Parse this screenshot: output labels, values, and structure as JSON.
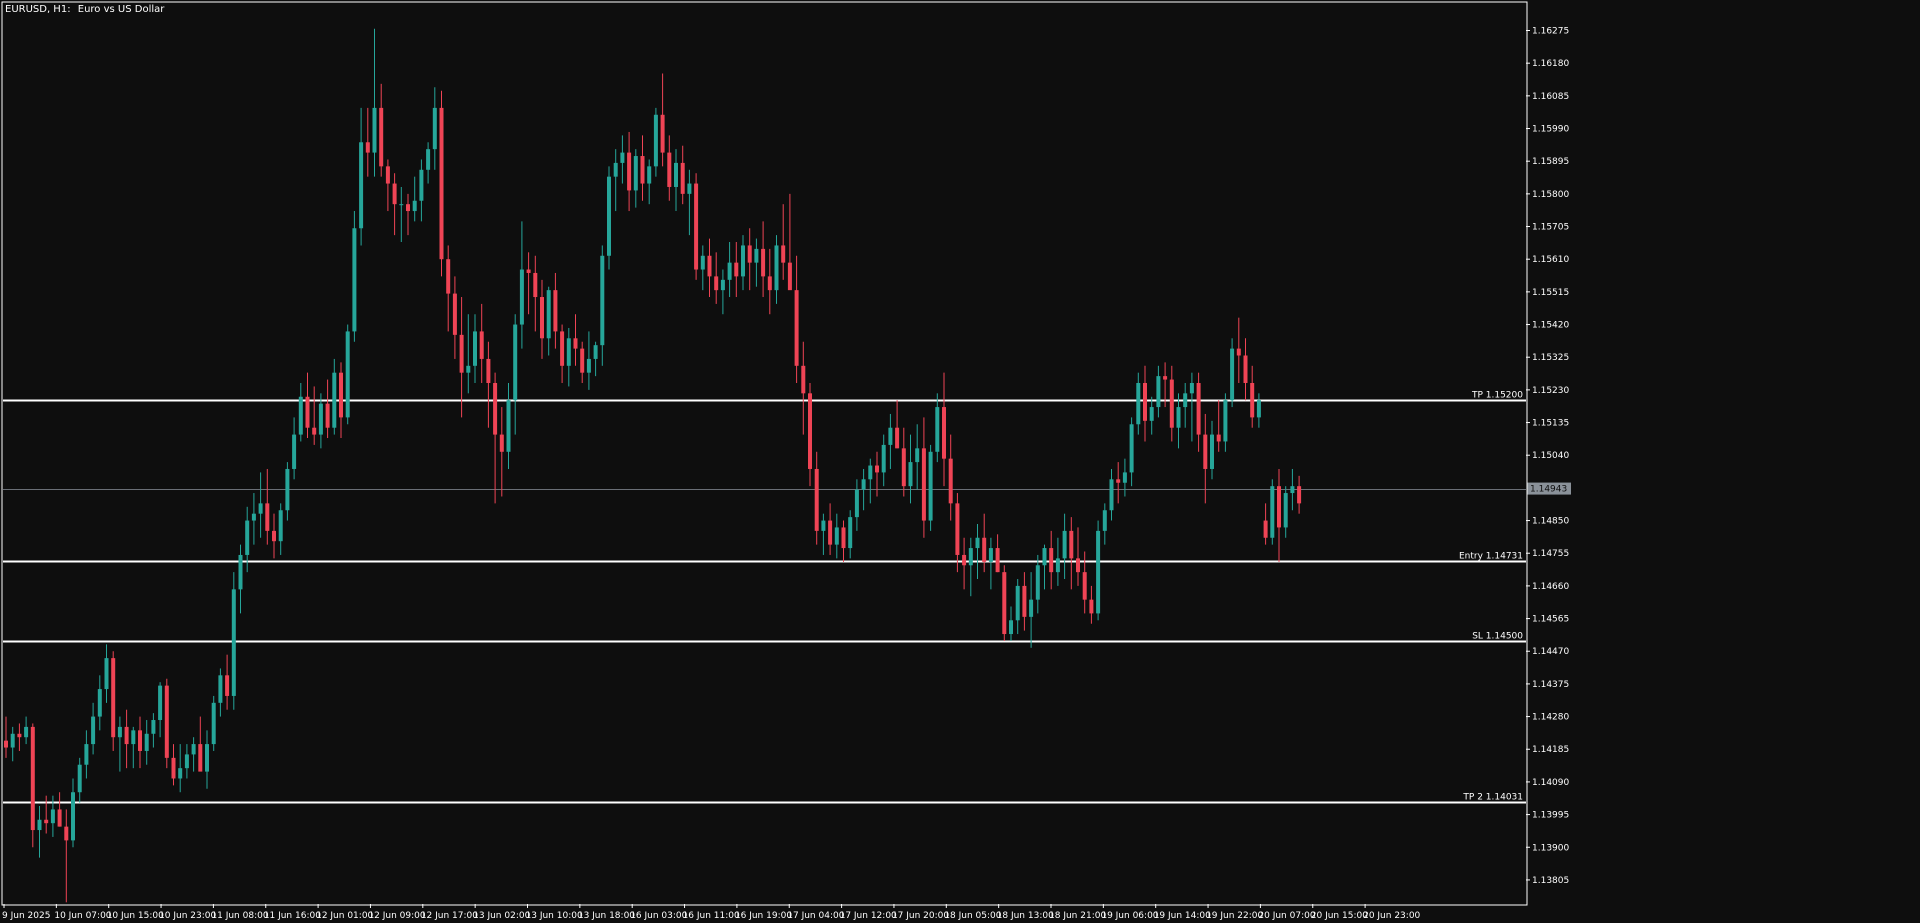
{
  "chart": {
    "symbol": "EURUSD, H1:",
    "description": "Euro vs US Dollar",
    "current_price": "1.14943"
  },
  "colors": {
    "background": "#0e0e0e",
    "bull": "#26a69a",
    "bear": "#ef4455",
    "axis": "#ffffff",
    "level_line": "#ffffff",
    "current_line": "#6a6f76",
    "price_tag": "#8a9199"
  },
  "levels": [
    {
      "label": "TP 1.15200",
      "price": 1.152
    },
    {
      "label": "Entry 1.14731",
      "price": 1.14731
    },
    {
      "label": "SL 1.14500",
      "price": 1.145
    },
    {
      "label": "TP 2 1.14031",
      "price": 1.14031
    }
  ],
  "chart_data": {
    "type": "candlestick",
    "ylim": [
      1.13735,
      1.16355
    ],
    "y_ticks": [
      "1.16275",
      "1.16180",
      "1.16085",
      "1.15990",
      "1.15895",
      "1.15800",
      "1.15705",
      "1.15610",
      "1.15515",
      "1.15420",
      "1.15325",
      "1.15230",
      "1.15135",
      "1.15040",
      "1.14943",
      "1.14850",
      "1.14755",
      "1.14660",
      "1.14565",
      "1.14470",
      "1.14375",
      "1.14280",
      "1.14185",
      "1.14090",
      "1.13995",
      "1.13900",
      "1.13805"
    ],
    "x_ticks": [
      "9 Jun 2025",
      "10 Jun 07:00",
      "10 Jun 15:00",
      "10 Jun 23:00",
      "11 Jun 08:00",
      "11 Jun 16:00",
      "12 Jun 01:00",
      "12 Jun 09:00",
      "12 Jun 17:00",
      "13 Jun 02:00",
      "13 Jun 10:00",
      "13 Jun 18:00",
      "16 Jun 03:00",
      "16 Jun 11:00",
      "16 Jun 19:00",
      "17 Jun 04:00",
      "17 Jun 12:00",
      "17 Jun 20:00",
      "18 Jun 05:00",
      "18 Jun 13:00",
      "18 Jun 21:00",
      "19 Jun 06:00",
      "19 Jun 14:00",
      "19 Jun 22:00",
      "20 Jun 07:00",
      "20 Jun 15:00",
      "20 Jun 23:00"
    ],
    "candles_ohlc": [
      [
        1.1421,
        1.1428,
        1.1416,
        1.1419
      ],
      [
        1.1419,
        1.1425,
        1.1415,
        1.1423
      ],
      [
        1.1423,
        1.1426,
        1.1418,
        1.1422
      ],
      [
        1.1422,
        1.1428,
        1.142,
        1.1425
      ],
      [
        1.1425,
        1.1426,
        1.139,
        1.1395
      ],
      [
        1.1395,
        1.1402,
        1.1387,
        1.1398
      ],
      [
        1.1398,
        1.1405,
        1.1394,
        1.1397
      ],
      [
        1.1397,
        1.1405,
        1.1393,
        1.1401
      ],
      [
        1.1401,
        1.1406,
        1.1396,
        1.1396
      ],
      [
        1.1396,
        1.1401,
        1.1374,
        1.1392
      ],
      [
        1.1392,
        1.141,
        1.139,
        1.1406
      ],
      [
        1.1406,
        1.1416,
        1.1403,
        1.1414
      ],
      [
        1.1414,
        1.1424,
        1.141,
        1.142
      ],
      [
        1.142,
        1.1432,
        1.1417,
        1.1428
      ],
      [
        1.1428,
        1.144,
        1.1424,
        1.1436
      ],
      [
        1.1436,
        1.1449,
        1.1432,
        1.1445
      ],
      [
        1.1445,
        1.1447,
        1.1418,
        1.1422
      ],
      [
        1.1422,
        1.1428,
        1.1412,
        1.1425
      ],
      [
        1.1425,
        1.143,
        1.1413,
        1.142
      ],
      [
        1.142,
        1.1425,
        1.1413,
        1.1424
      ],
      [
        1.1424,
        1.1428,
        1.1413,
        1.1418
      ],
      [
        1.1418,
        1.1427,
        1.1414,
        1.1423
      ],
      [
        1.1423,
        1.1429,
        1.1419,
        1.1427
      ],
      [
        1.1427,
        1.1438,
        1.1422,
        1.1437
      ],
      [
        1.1437,
        1.1439,
        1.1413,
        1.1416
      ],
      [
        1.1416,
        1.142,
        1.1408,
        1.141
      ],
      [
        1.141,
        1.142,
        1.1406,
        1.1413
      ],
      [
        1.1413,
        1.142,
        1.141,
        1.1417
      ],
      [
        1.1417,
        1.1422,
        1.1412,
        1.142
      ],
      [
        1.142,
        1.1428,
        1.1414,
        1.1412
      ],
      [
        1.1412,
        1.1424,
        1.1407,
        1.142
      ],
      [
        1.142,
        1.1434,
        1.1418,
        1.1432
      ],
      [
        1.1432,
        1.1442,
        1.1428,
        1.144
      ],
      [
        1.144,
        1.1446,
        1.143,
        1.1434
      ],
      [
        1.1434,
        1.147,
        1.143,
        1.1465
      ],
      [
        1.1465,
        1.1478,
        1.1458,
        1.1475
      ],
      [
        1.1475,
        1.1489,
        1.147,
        1.1485
      ],
      [
        1.1485,
        1.1493,
        1.1478,
        1.1487
      ],
      [
        1.1487,
        1.1499,
        1.148,
        1.149
      ],
      [
        1.149,
        1.15,
        1.1478,
        1.1482
      ],
      [
        1.1482,
        1.1487,
        1.1474,
        1.1479
      ],
      [
        1.1479,
        1.149,
        1.1475,
        1.1488
      ],
      [
        1.1488,
        1.1502,
        1.1485,
        1.15
      ],
      [
        1.15,
        1.1515,
        1.1497,
        1.151
      ],
      [
        1.151,
        1.1525,
        1.1508,
        1.1521
      ],
      [
        1.1521,
        1.1528,
        1.1509,
        1.1512
      ],
      [
        1.1512,
        1.1524,
        1.1507,
        1.151
      ],
      [
        1.151,
        1.1522,
        1.1506,
        1.1519
      ],
      [
        1.1519,
        1.1526,
        1.1509,
        1.1512
      ],
      [
        1.1512,
        1.1532,
        1.151,
        1.1528
      ],
      [
        1.1528,
        1.1531,
        1.1509,
        1.1515
      ],
      [
        1.1515,
        1.1542,
        1.1513,
        1.154
      ],
      [
        1.154,
        1.1575,
        1.1537,
        1.157
      ],
      [
        1.157,
        1.1605,
        1.1565,
        1.1595
      ],
      [
        1.1595,
        1.1605,
        1.1585,
        1.1592
      ],
      [
        1.1592,
        1.1628,
        1.1585,
        1.1605
      ],
      [
        1.1605,
        1.1612,
        1.1585,
        1.1588
      ],
      [
        1.1588,
        1.159,
        1.1575,
        1.1583
      ],
      [
        1.1583,
        1.1586,
        1.1568,
        1.1577
      ],
      [
        1.1577,
        1.1582,
        1.1566,
        1.1577
      ],
      [
        1.1577,
        1.158,
        1.1568,
        1.1575
      ],
      [
        1.1575,
        1.1585,
        1.1572,
        1.1578
      ],
      [
        1.1578,
        1.159,
        1.1572,
        1.1587
      ],
      [
        1.1587,
        1.1595,
        1.1583,
        1.1593
      ],
      [
        1.1593,
        1.1611,
        1.1587,
        1.1605
      ],
      [
        1.1605,
        1.161,
        1.1556,
        1.1561
      ],
      [
        1.1561,
        1.1565,
        1.154,
        1.1551
      ],
      [
        1.1551,
        1.1556,
        1.1532,
        1.1539
      ],
      [
        1.1539,
        1.155,
        1.1515,
        1.1528
      ],
      [
        1.1528,
        1.1545,
        1.1522,
        1.153
      ],
      [
        1.153,
        1.1545,
        1.1525,
        1.154
      ],
      [
        1.154,
        1.1548,
        1.1525,
        1.1532
      ],
      [
        1.1532,
        1.1537,
        1.1512,
        1.1525
      ],
      [
        1.1525,
        1.1528,
        1.149,
        1.151
      ],
      [
        1.151,
        1.1518,
        1.1492,
        1.1505
      ],
      [
        1.1505,
        1.1525,
        1.15,
        1.152
      ],
      [
        1.152,
        1.1545,
        1.151,
        1.1542
      ],
      [
        1.1542,
        1.1572,
        1.1535,
        1.1558
      ],
      [
        1.1558,
        1.1563,
        1.1545,
        1.1557
      ],
      [
        1.1557,
        1.1562,
        1.154,
        1.155
      ],
      [
        1.155,
        1.1555,
        1.1532,
        1.1538
      ],
      [
        1.1538,
        1.1553,
        1.1533,
        1.1552
      ],
      [
        1.1552,
        1.1557,
        1.1535,
        1.154
      ],
      [
        1.154,
        1.1542,
        1.1525,
        1.153
      ],
      [
        1.153,
        1.1541,
        1.1524,
        1.1538
      ],
      [
        1.1538,
        1.1545,
        1.153,
        1.1535
      ],
      [
        1.1535,
        1.1537,
        1.1525,
        1.1528
      ],
      [
        1.1528,
        1.154,
        1.1523,
        1.1532
      ],
      [
        1.1532,
        1.1537,
        1.1527,
        1.1536
      ],
      [
        1.1536,
        1.1565,
        1.153,
        1.1562
      ],
      [
        1.1562,
        1.1588,
        1.1558,
        1.1585
      ],
      [
        1.1585,
        1.1593,
        1.1575,
        1.1589
      ],
      [
        1.1589,
        1.1597,
        1.1583,
        1.1592
      ],
      [
        1.1592,
        1.1598,
        1.1575,
        1.1581
      ],
      [
        1.1581,
        1.1593,
        1.1576,
        1.1591
      ],
      [
        1.1591,
        1.1597,
        1.1578,
        1.1583
      ],
      [
        1.1583,
        1.159,
        1.1577,
        1.1588
      ],
      [
        1.1588,
        1.1605,
        1.1585,
        1.1603
      ],
      [
        1.1603,
        1.1615,
        1.1588,
        1.1592
      ],
      [
        1.1592,
        1.1597,
        1.1578,
        1.1582
      ],
      [
        1.1582,
        1.1593,
        1.1575,
        1.1589
      ],
      [
        1.1589,
        1.1594,
        1.1577,
        1.158
      ],
      [
        1.158,
        1.1587,
        1.1568,
        1.1583
      ],
      [
        1.1583,
        1.1586,
        1.1555,
        1.1558
      ],
      [
        1.1558,
        1.1565,
        1.1552,
        1.1562
      ],
      [
        1.1562,
        1.1567,
        1.155,
        1.1556
      ],
      [
        1.1556,
        1.1563,
        1.1548,
        1.1552
      ],
      [
        1.1552,
        1.1558,
        1.1545,
        1.1555
      ],
      [
        1.1555,
        1.1566,
        1.155,
        1.156
      ],
      [
        1.156,
        1.1566,
        1.155,
        1.1556
      ],
      [
        1.1556,
        1.1568,
        1.1552,
        1.1565
      ],
      [
        1.1565,
        1.157,
        1.1552,
        1.156
      ],
      [
        1.156,
        1.1567,
        1.1553,
        1.1564
      ],
      [
        1.1564,
        1.1572,
        1.155,
        1.1556
      ],
      [
        1.1556,
        1.1564,
        1.1545,
        1.1552
      ],
      [
        1.1552,
        1.1568,
        1.1548,
        1.1565
      ],
      [
        1.1565,
        1.1577,
        1.1555,
        1.156
      ],
      [
        1.156,
        1.158,
        1.1555,
        1.1552
      ],
      [
        1.1552,
        1.1562,
        1.1525,
        1.153
      ],
      [
        1.153,
        1.1537,
        1.151,
        1.1522
      ],
      [
        1.1522,
        1.1525,
        1.1495,
        1.15
      ],
      [
        1.15,
        1.1505,
        1.1478,
        1.1482
      ],
      [
        1.1482,
        1.1487,
        1.1475,
        1.1485
      ],
      [
        1.1485,
        1.149,
        1.1475,
        1.1478
      ],
      [
        1.1478,
        1.1487,
        1.1474,
        1.1483
      ],
      [
        1.1483,
        1.1485,
        1.1473,
        1.1477
      ],
      [
        1.1477,
        1.1488,
        1.1474,
        1.1486
      ],
      [
        1.1486,
        1.1497,
        1.1482,
        1.1494
      ],
      [
        1.1494,
        1.15,
        1.1488,
        1.1497
      ],
      [
        1.1497,
        1.1503,
        1.149,
        1.1501
      ],
      [
        1.1501,
        1.1505,
        1.1492,
        1.1499
      ],
      [
        1.1499,
        1.151,
        1.1495,
        1.1507
      ],
      [
        1.1507,
        1.1516,
        1.15,
        1.1512
      ],
      [
        1.1512,
        1.152,
        1.1506,
        1.1506
      ],
      [
        1.1506,
        1.1512,
        1.1492,
        1.1495
      ],
      [
        1.1495,
        1.151,
        1.149,
        1.1502
      ],
      [
        1.1502,
        1.1513,
        1.1494,
        1.1506
      ],
      [
        1.1506,
        1.1515,
        1.148,
        1.1485
      ],
      [
        1.1485,
        1.1507,
        1.1482,
        1.1505
      ],
      [
        1.1505,
        1.1522,
        1.1502,
        1.1518
      ],
      [
        1.1518,
        1.1528,
        1.1495,
        1.1503
      ],
      [
        1.1503,
        1.151,
        1.1485,
        1.149
      ],
      [
        1.149,
        1.1493,
        1.147,
        1.1475
      ],
      [
        1.1475,
        1.148,
        1.1465,
        1.1472
      ],
      [
        1.1472,
        1.148,
        1.1463,
        1.1477
      ],
      [
        1.1477,
        1.1484,
        1.1468,
        1.148
      ],
      [
        1.148,
        1.1487,
        1.147,
        1.1473
      ],
      [
        1.1473,
        1.148,
        1.1465,
        1.1477
      ],
      [
        1.1477,
        1.1481,
        1.147,
        1.147
      ],
      [
        1.147,
        1.1472,
        1.145,
        1.1452
      ],
      [
        1.1452,
        1.146,
        1.145,
        1.1456
      ],
      [
        1.1456,
        1.1468,
        1.1452,
        1.1466
      ],
      [
        1.1466,
        1.147,
        1.1453,
        1.1457
      ],
      [
        1.1457,
        1.147,
        1.1448,
        1.1462
      ],
      [
        1.1462,
        1.1475,
        1.1458,
        1.1472
      ],
      [
        1.1472,
        1.1478,
        1.1465,
        1.1477
      ],
      [
        1.1477,
        1.1482,
        1.1465,
        1.147
      ],
      [
        1.147,
        1.148,
        1.1466,
        1.1474
      ],
      [
        1.1474,
        1.1487,
        1.1468,
        1.1482
      ],
      [
        1.1482,
        1.1486,
        1.1465,
        1.1474
      ],
      [
        1.1474,
        1.1483,
        1.1466,
        1.147
      ],
      [
        1.147,
        1.1476,
        1.1458,
        1.1462
      ],
      [
        1.1462,
        1.1466,
        1.1455,
        1.1458
      ],
      [
        1.1458,
        1.1485,
        1.1456,
        1.1482
      ],
      [
        1.1482,
        1.149,
        1.1478,
        1.1488
      ],
      [
        1.1488,
        1.15,
        1.1485,
        1.1497
      ],
      [
        1.1497,
        1.1502,
        1.149,
        1.1496
      ],
      [
        1.1496,
        1.1503,
        1.1492,
        1.1499
      ],
      [
        1.1499,
        1.1515,
        1.1495,
        1.1513
      ],
      [
        1.1513,
        1.1528,
        1.151,
        1.1525
      ],
      [
        1.1525,
        1.153,
        1.1508,
        1.1514
      ],
      [
        1.1514,
        1.1521,
        1.151,
        1.1518
      ],
      [
        1.1518,
        1.153,
        1.1515,
        1.1527
      ],
      [
        1.1527,
        1.1531,
        1.1518,
        1.1526
      ],
      [
        1.1526,
        1.153,
        1.1508,
        1.1512
      ],
      [
        1.1512,
        1.1522,
        1.1506,
        1.1518
      ],
      [
        1.1518,
        1.1525,
        1.1512,
        1.1522
      ],
      [
        1.1522,
        1.1528,
        1.1508,
        1.1525
      ],
      [
        1.1525,
        1.1528,
        1.1505,
        1.151
      ],
      [
        1.151,
        1.1516,
        1.149,
        1.15
      ],
      [
        1.15,
        1.1514,
        1.1497,
        1.151
      ],
      [
        1.151,
        1.152,
        1.1505,
        1.1508
      ],
      [
        1.1508,
        1.1522,
        1.1505,
        1.152
      ],
      [
        1.152,
        1.1538,
        1.1518,
        1.1535
      ],
      [
        1.1535,
        1.1544,
        1.1525,
        1.1533
      ],
      [
        1.1533,
        1.1538,
        1.152,
        1.1525
      ],
      [
        1.1525,
        1.153,
        1.1512,
        1.1515
      ],
      [
        1.1515,
        1.1522,
        1.1512,
        1.152
      ],
      [
        1.1485,
        1.149,
        1.1478,
        1.148
      ],
      [
        1.148,
        1.1497,
        1.1478,
        1.1495
      ],
      [
        1.1495,
        1.15,
        1.1473,
        1.1483
      ],
      [
        1.1483,
        1.1495,
        1.148,
        1.1493
      ],
      [
        1.1493,
        1.15,
        1.1488,
        1.1495
      ],
      [
        1.1495,
        1.1498,
        1.1487,
        1.149
      ]
    ]
  }
}
